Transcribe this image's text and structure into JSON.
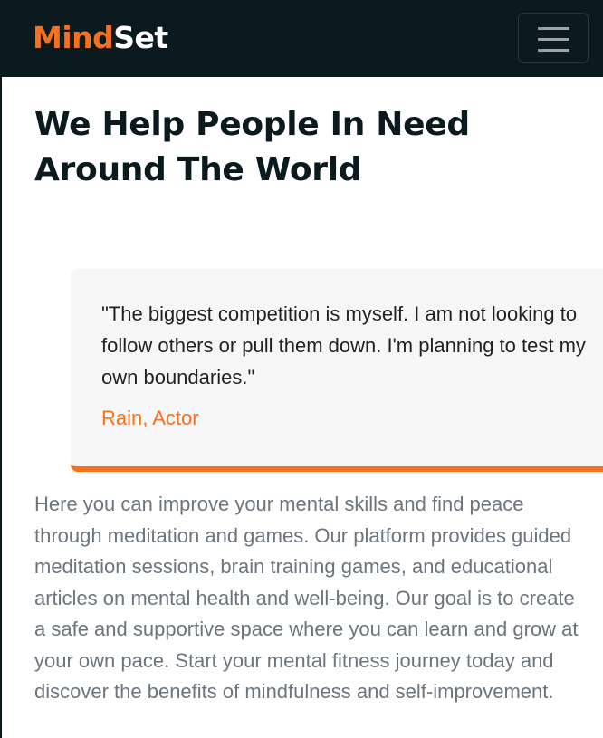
{
  "navbar": {
    "brand_part1": "Mind",
    "brand_part2": "Set",
    "toggle_icon": "hamburger-menu-icon"
  },
  "hero": {
    "title": "We Help People In Need Around The World"
  },
  "quote": {
    "text": "\"The biggest competition is myself. I am not looking to follow others or pull them down. I'm planning to test my own boundaries.\"",
    "author": "Rain, Actor"
  },
  "description": {
    "text": "Here you can improve your mental skills and find peace through meditation and games. Our platform provides guided meditation sessions, brain training games, and educational articles on mental health and well-being. Our goal is to create a safe and supportive space where you can learn and grow at your own pace. Start your mental fitness journey today and discover the benefits of mindfulness and self-improvement."
  },
  "colors": {
    "navbar_bg": "#0b1a1f",
    "accent": "#f7701f",
    "quote_bg": "#f6f6f6",
    "body_text": "#6c757d"
  }
}
